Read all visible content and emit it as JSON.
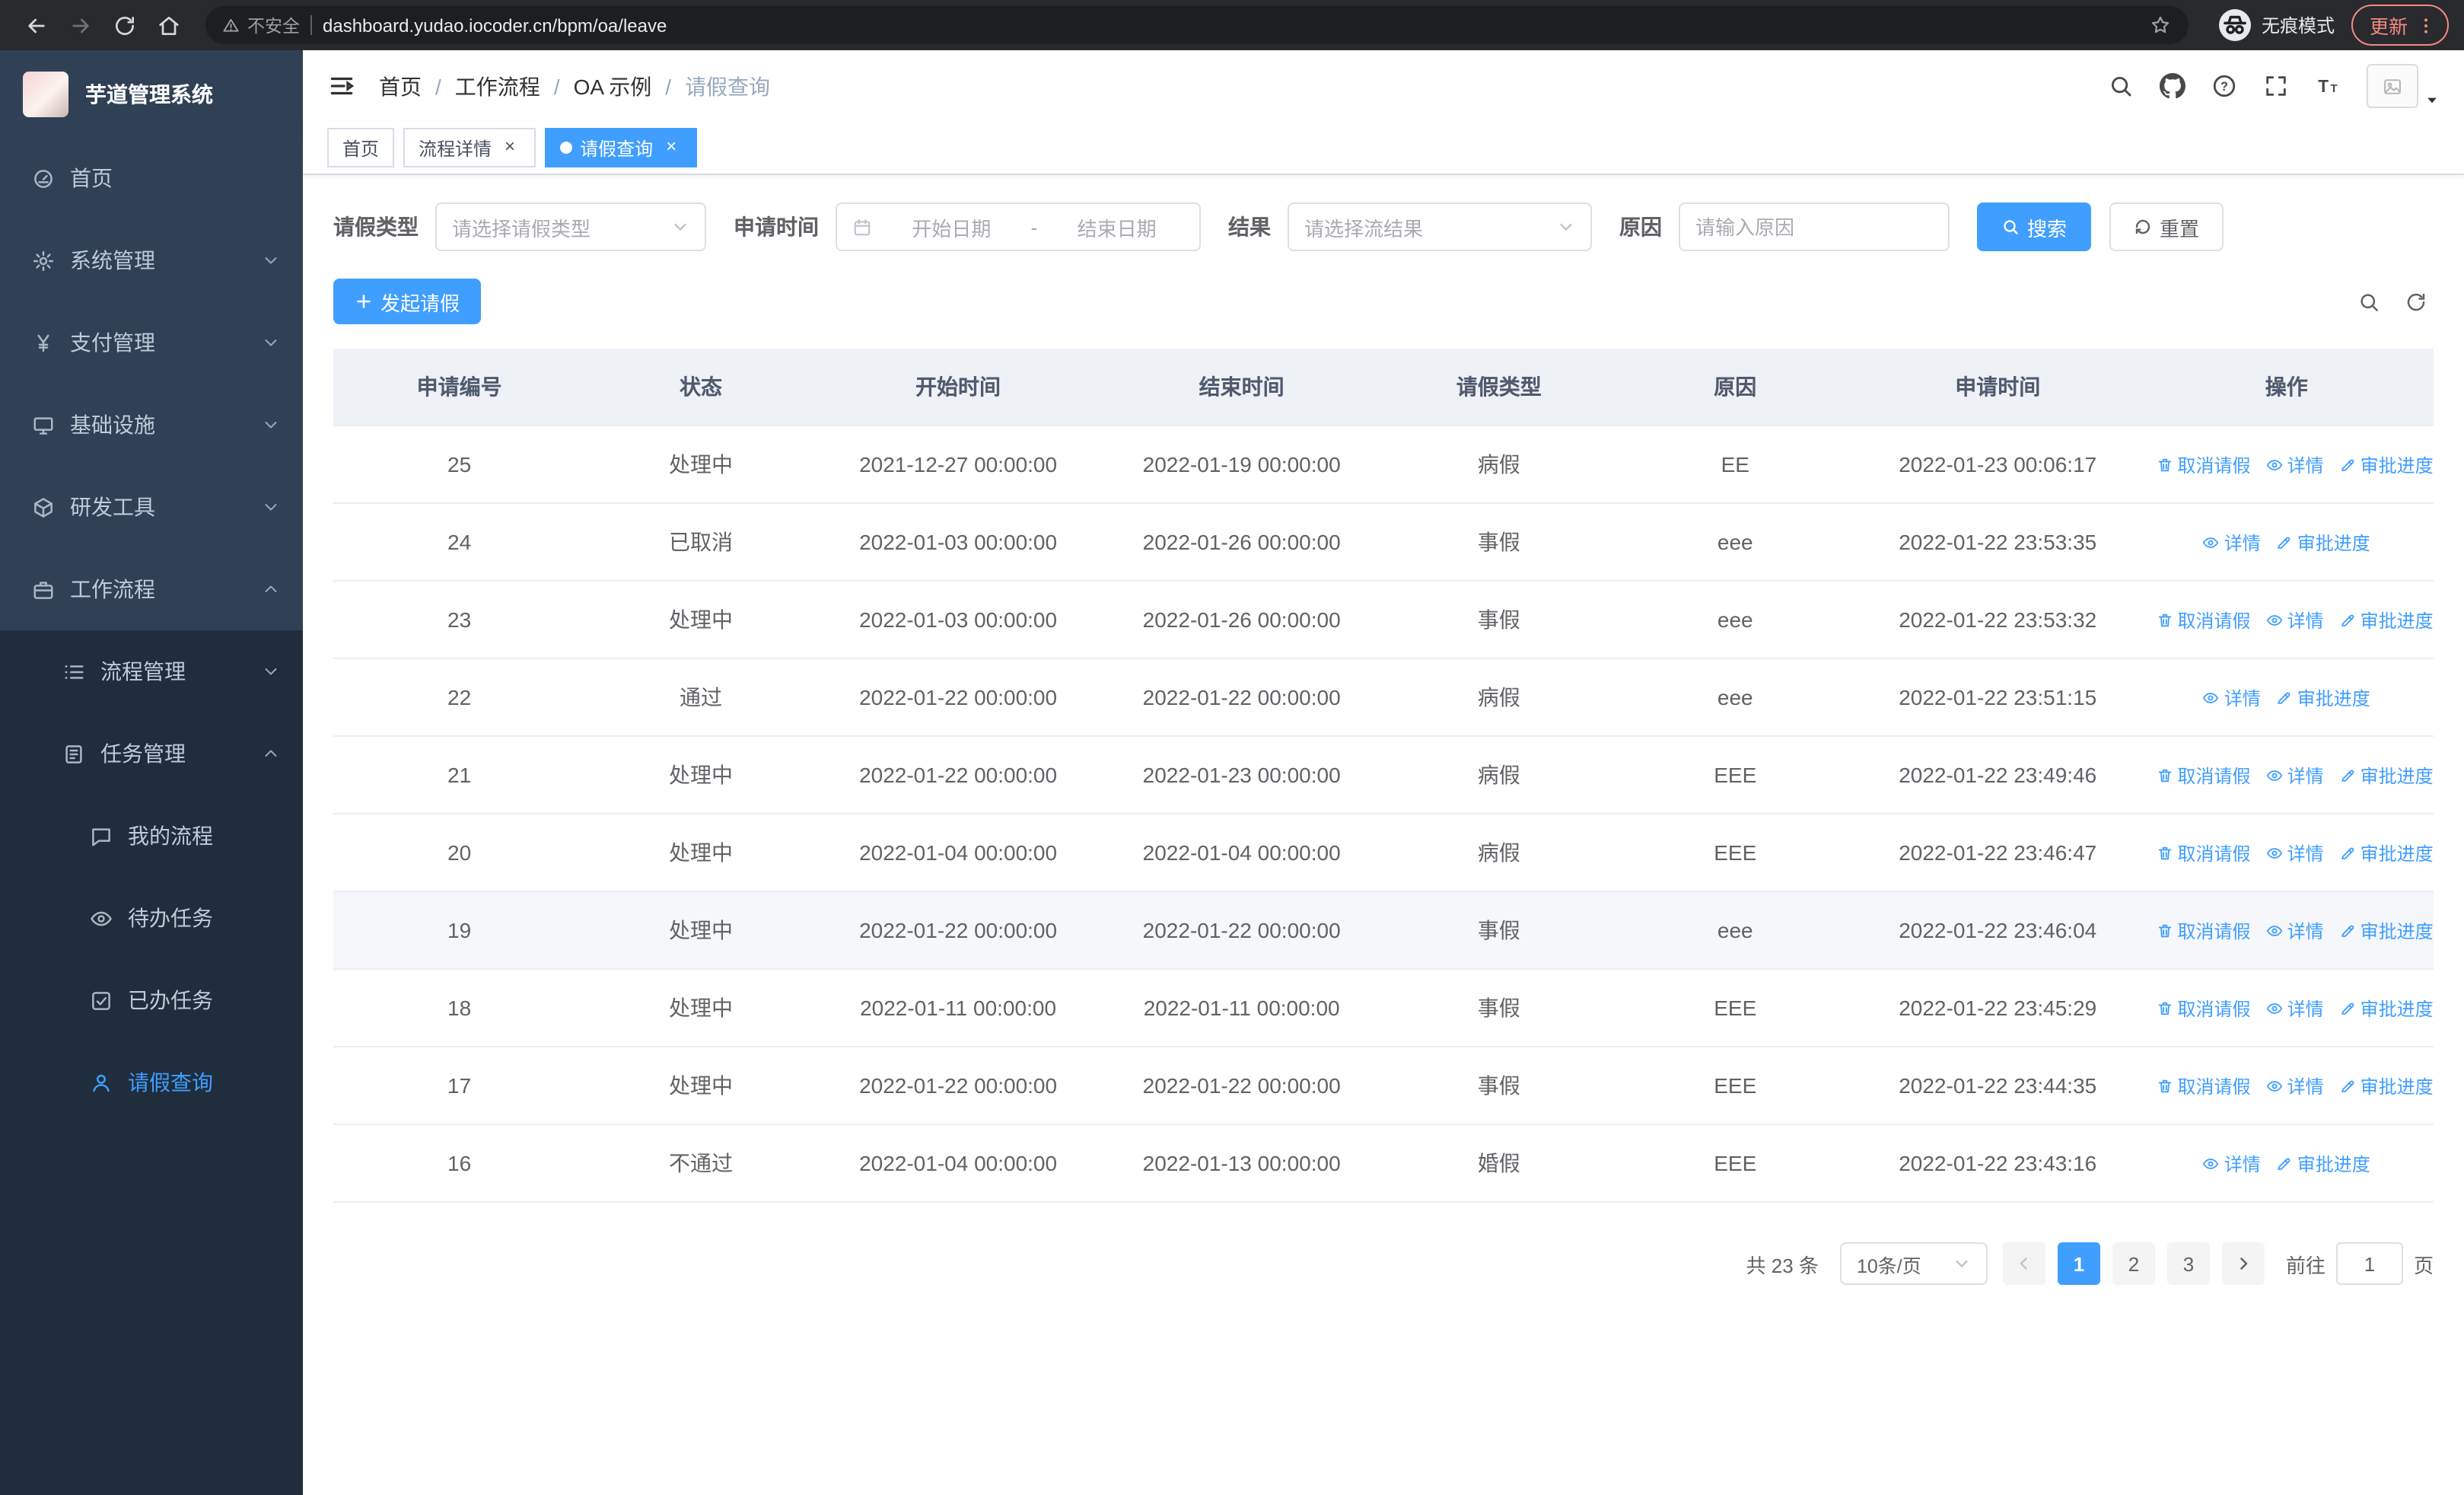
{
  "colors": {
    "primary": "#409EFF",
    "sidebar_bg": "#304156",
    "sidebar_sub_bg": "#1f2d3d",
    "danger": "#f28b82"
  },
  "browser": {
    "security_label": "不安全",
    "url": "dashboard.yudao.iocoder.cn/bpm/oa/leave",
    "incognito_label": "无痕模式",
    "update_label": "更新"
  },
  "sidebar": {
    "title": "芋道管理系统",
    "menu": [
      {
        "key": "home",
        "label": "首页",
        "icon": "gauge-icon",
        "level": 1
      },
      {
        "key": "system",
        "label": "系统管理",
        "icon": "gear-icon",
        "level": 1,
        "arrow": "down"
      },
      {
        "key": "payment",
        "label": "支付管理",
        "icon": "yen-icon",
        "level": 1,
        "arrow": "down"
      },
      {
        "key": "infra",
        "label": "基础设施",
        "icon": "monitor-icon",
        "level": 1,
        "arrow": "down"
      },
      {
        "key": "devtools",
        "label": "研发工具",
        "icon": "box-icon",
        "level": 1,
        "arrow": "down"
      },
      {
        "key": "workflow",
        "label": "工作流程",
        "icon": "briefcase-icon",
        "level": 1,
        "arrow": "up"
      },
      {
        "key": "process",
        "label": "流程管理",
        "icon": "list-icon",
        "level": 2,
        "arrow": "down",
        "dark": true
      },
      {
        "key": "task",
        "label": "任务管理",
        "icon": "clipboard-icon",
        "level": 2,
        "arrow": "up",
        "dark": true
      },
      {
        "key": "my-process",
        "label": "我的流程",
        "icon": "chat-icon",
        "level": 3,
        "dark": true
      },
      {
        "key": "todo-task",
        "label": "待办任务",
        "icon": "eye-icon",
        "level": 3,
        "dark": true
      },
      {
        "key": "done-task",
        "label": "已办任务",
        "icon": "check-square-icon",
        "level": 3,
        "dark": true
      },
      {
        "key": "leave-query",
        "label": "请假查询",
        "icon": "user-icon",
        "level": 3,
        "dark": true,
        "active": true
      }
    ]
  },
  "header": {
    "breadcrumb": [
      {
        "label": "首页"
      },
      {
        "label": "工作流程"
      },
      {
        "label": "OA 示例"
      },
      {
        "label": "请假查询",
        "current": true
      }
    ]
  },
  "tags": [
    {
      "label": "首页"
    },
    {
      "label": "流程详情",
      "closable": true
    },
    {
      "label": "请假查询",
      "closable": true,
      "active": true
    }
  ],
  "filters": {
    "leave_type_label": "请假类型",
    "leave_type_placeholder": "请选择请假类型",
    "apply_time_label": "申请时间",
    "start_date_placeholder": "开始日期",
    "date_separator": "-",
    "end_date_placeholder": "结束日期",
    "result_label": "结果",
    "result_placeholder": "请选择流结果",
    "reason_label": "原因",
    "reason_placeholder": "请输入原因",
    "search_button": "搜索",
    "reset_button": "重置"
  },
  "toolbar": {
    "create_label": "发起请假"
  },
  "table": {
    "columns": [
      "申请编号",
      "状态",
      "开始时间",
      "结束时间",
      "请假类型",
      "原因",
      "申请时间",
      "操作"
    ],
    "action_labels": {
      "cancel": "取消请假",
      "detail": "详情",
      "progress": "审批进度"
    },
    "rows": [
      {
        "id": "25",
        "status": "处理中",
        "start_time": "2021-12-27 00:00:00",
        "end_time": "2022-01-19 00:00:00",
        "leave_type": "病假",
        "reason": "EE",
        "apply_time": "2022-01-23 00:06:17",
        "actions": [
          "cancel",
          "detail",
          "progress"
        ],
        "highlight": false
      },
      {
        "id": "24",
        "status": "已取消",
        "start_time": "2022-01-03 00:00:00",
        "end_time": "2022-01-26 00:00:00",
        "leave_type": "事假",
        "reason": "eee",
        "apply_time": "2022-01-22 23:53:35",
        "actions": [
          "detail",
          "progress"
        ],
        "highlight": false
      },
      {
        "id": "23",
        "status": "处理中",
        "start_time": "2022-01-03 00:00:00",
        "end_time": "2022-01-26 00:00:00",
        "leave_type": "事假",
        "reason": "eee",
        "apply_time": "2022-01-22 23:53:32",
        "actions": [
          "cancel",
          "detail",
          "progress"
        ],
        "highlight": false
      },
      {
        "id": "22",
        "status": "通过",
        "start_time": "2022-01-22 00:00:00",
        "end_time": "2022-01-22 00:00:00",
        "leave_type": "病假",
        "reason": "eee",
        "apply_time": "2022-01-22 23:51:15",
        "actions": [
          "detail",
          "progress"
        ],
        "highlight": false
      },
      {
        "id": "21",
        "status": "处理中",
        "start_time": "2022-01-22 00:00:00",
        "end_time": "2022-01-23 00:00:00",
        "leave_type": "病假",
        "reason": "EEE",
        "apply_time": "2022-01-22 23:49:46",
        "actions": [
          "cancel",
          "detail",
          "progress"
        ],
        "highlight": false
      },
      {
        "id": "20",
        "status": "处理中",
        "start_time": "2022-01-04 00:00:00",
        "end_time": "2022-01-04 00:00:00",
        "leave_type": "病假",
        "reason": "EEE",
        "apply_time": "2022-01-22 23:46:47",
        "actions": [
          "cancel",
          "detail",
          "progress"
        ],
        "highlight": false
      },
      {
        "id": "19",
        "status": "处理中",
        "start_time": "2022-01-22 00:00:00",
        "end_time": "2022-01-22 00:00:00",
        "leave_type": "事假",
        "reason": "eee",
        "apply_time": "2022-01-22 23:46:04",
        "actions": [
          "cancel",
          "detail",
          "progress"
        ],
        "highlight": true
      },
      {
        "id": "18",
        "status": "处理中",
        "start_time": "2022-01-11 00:00:00",
        "end_time": "2022-01-11 00:00:00",
        "leave_type": "事假",
        "reason": "EEE",
        "apply_time": "2022-01-22 23:45:29",
        "actions": [
          "cancel",
          "detail",
          "progress"
        ],
        "highlight": false
      },
      {
        "id": "17",
        "status": "处理中",
        "start_time": "2022-01-22 00:00:00",
        "end_time": "2022-01-22 00:00:00",
        "leave_type": "事假",
        "reason": "EEE",
        "apply_time": "2022-01-22 23:44:35",
        "actions": [
          "cancel",
          "detail",
          "progress"
        ],
        "highlight": false
      },
      {
        "id": "16",
        "status": "不通过",
        "start_time": "2022-01-04 00:00:00",
        "end_time": "2022-01-13 00:00:00",
        "leave_type": "婚假",
        "reason": "EEE",
        "apply_time": "2022-01-22 23:43:16",
        "actions": [
          "detail",
          "progress"
        ],
        "highlight": false
      }
    ]
  },
  "pagination": {
    "total_text": "共 23 条",
    "page_size": "10条/页",
    "pages": [
      "1",
      "2",
      "3"
    ],
    "active_page": "1",
    "goto_label": "前往",
    "goto_value": "1",
    "goto_suffix": "页"
  }
}
